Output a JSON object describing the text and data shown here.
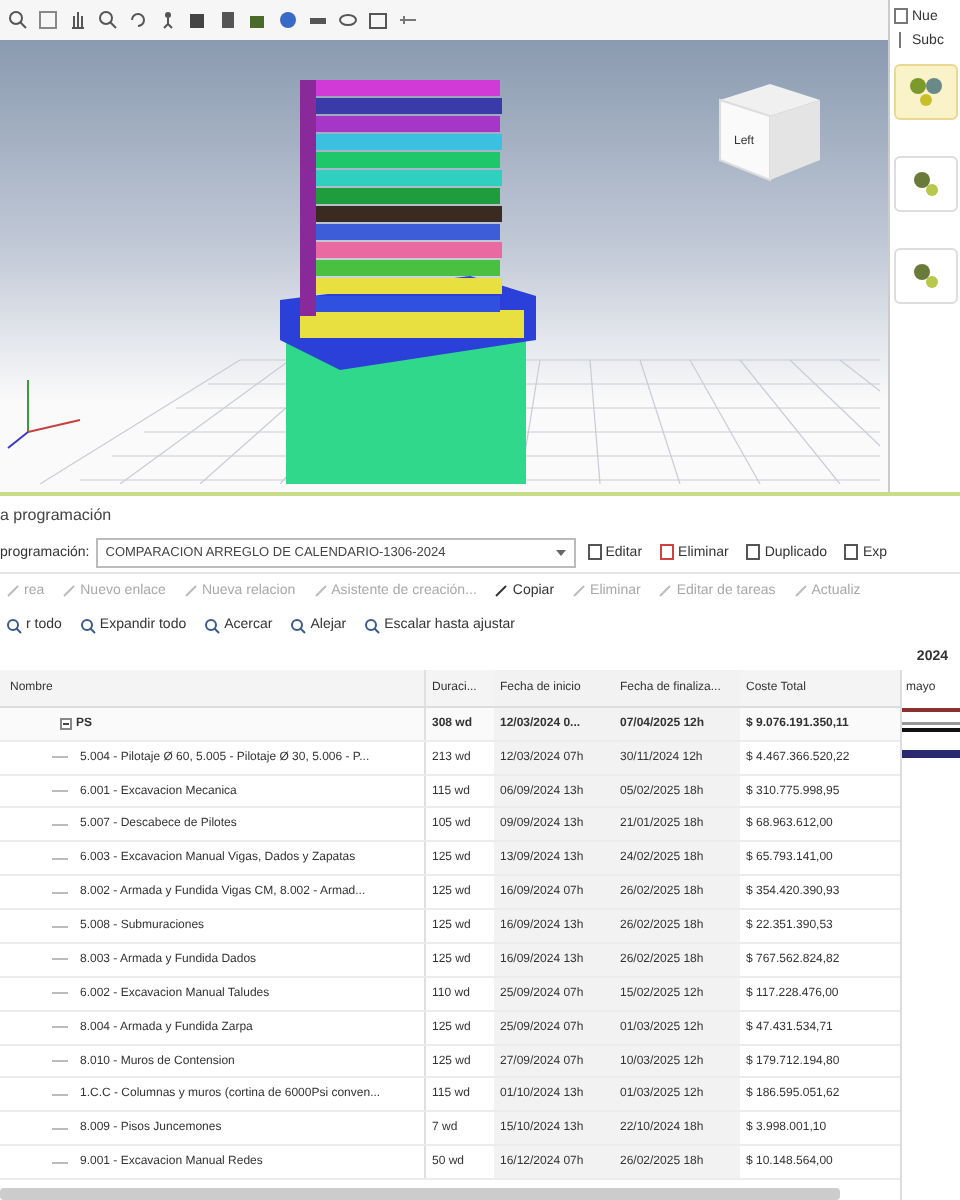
{
  "viewport": {
    "cube_label": "Left"
  },
  "side_panel": {
    "new_button": "Nue",
    "sub_button": "Subc"
  },
  "section_title": "a programación",
  "schedule_bar": {
    "label": "programación:",
    "value": "COMPARACION ARREGLO DE CALENDARIO-1306-2024",
    "buttons": [
      "Editar",
      "Eliminar",
      "Duplicado",
      "Exp"
    ]
  },
  "task_toolbar": [
    {
      "label": "rea",
      "disabled": true
    },
    {
      "label": "Nuevo enlace",
      "disabled": true
    },
    {
      "label": "Nueva relacion",
      "disabled": true
    },
    {
      "label": "Asistente de creación...",
      "disabled": true
    },
    {
      "label": "Copiar",
      "disabled": false
    },
    {
      "label": "Eliminar",
      "disabled": true
    },
    {
      "label": "Editar de tareas",
      "disabled": true
    },
    {
      "label": "Actualiz",
      "disabled": true
    }
  ],
  "view_toolbar": [
    "r todo",
    "Expandir todo",
    "Acercar",
    "Alejar",
    "Escalar hasta ajustar"
  ],
  "gantt": {
    "year": "2024",
    "month": "mayo"
  },
  "table": {
    "columns": [
      "Nombre",
      "Duraci...",
      "Fecha de inicio",
      "Fecha de finaliza...",
      "Coste Total"
    ],
    "rows": [
      {
        "name": "PS",
        "duration": "308 wd",
        "start": "12/03/2024 0...",
        "end": "07/04/2025 12h",
        "cost": "$ 9.076.191.350,11",
        "summary": true
      },
      {
        "name": "5.004 - Pilotaje Ø 60, 5.005 - Pilotaje Ø 30, 5.006 - P...",
        "duration": "213 wd",
        "start": "12/03/2024 07h",
        "end": "30/11/2024 12h",
        "cost": "$ 4.467.366.520,22",
        "summary": false
      },
      {
        "name": "6.001 - Excavacion Mecanica",
        "duration": "115 wd",
        "start": "06/09/2024 13h",
        "end": "05/02/2025 18h",
        "cost": "$ 310.775.998,95",
        "summary": false
      },
      {
        "name": "5.007 - Descabece de Pilotes",
        "duration": "105 wd",
        "start": "09/09/2024 13h",
        "end": "21/01/2025 18h",
        "cost": "$ 68.963.612,00",
        "summary": false
      },
      {
        "name": "6.003 - Excavacion Manual Vigas, Dados y Zapatas",
        "duration": "125 wd",
        "start": "13/09/2024 13h",
        "end": "24/02/2025 18h",
        "cost": "$ 65.793.141,00",
        "summary": false
      },
      {
        "name": "8.002 - Armada y Fundida Vigas CM, 8.002 - Armad...",
        "duration": "125 wd",
        "start": "16/09/2024 07h",
        "end": "26/02/2025 18h",
        "cost": "$ 354.420.390,93",
        "summary": false
      },
      {
        "name": "5.008 - Submuraciones",
        "duration": "125 wd",
        "start": "16/09/2024 13h",
        "end": "26/02/2025 18h",
        "cost": "$ 22.351.390,53",
        "summary": false
      },
      {
        "name": "8.003 - Armada y Fundida Dados",
        "duration": "125 wd",
        "start": "16/09/2024 13h",
        "end": "26/02/2025 18h",
        "cost": "$ 767.562.824,82",
        "summary": false
      },
      {
        "name": "6.002 - Excavacion Manual Taludes",
        "duration": "110 wd",
        "start": "25/09/2024 07h",
        "end": "15/02/2025 12h",
        "cost": "$ 117.228.476,00",
        "summary": false
      },
      {
        "name": "8.004 - Armada y Fundida Zarpa",
        "duration": "125 wd",
        "start": "25/09/2024 07h",
        "end": "01/03/2025 12h",
        "cost": "$ 47.431.534,71",
        "summary": false
      },
      {
        "name": "8.010 - Muros de Contension",
        "duration": "125 wd",
        "start": "27/09/2024 07h",
        "end": "10/03/2025 12h",
        "cost": "$ 179.712.194,80",
        "summary": false
      },
      {
        "name": "1.C.C - Columnas y muros (cortina de 6000Psi conven...",
        "duration": "115 wd",
        "start": "01/10/2024 13h",
        "end": "01/03/2025 12h",
        "cost": "$ 186.595.051,62",
        "summary": false
      },
      {
        "name": "8.009 - Pisos Juncemones",
        "duration": "7 wd",
        "start": "15/10/2024 13h",
        "end": "22/10/2024 18h",
        "cost": "$ 3.998.001,10",
        "summary": false
      },
      {
        "name": "9.001 - Excavacion Manual Redes",
        "duration": "50 wd",
        "start": "16/12/2024 07h",
        "end": "26/02/2025 18h",
        "cost": "$ 10.148.564,00",
        "summary": false
      }
    ]
  }
}
